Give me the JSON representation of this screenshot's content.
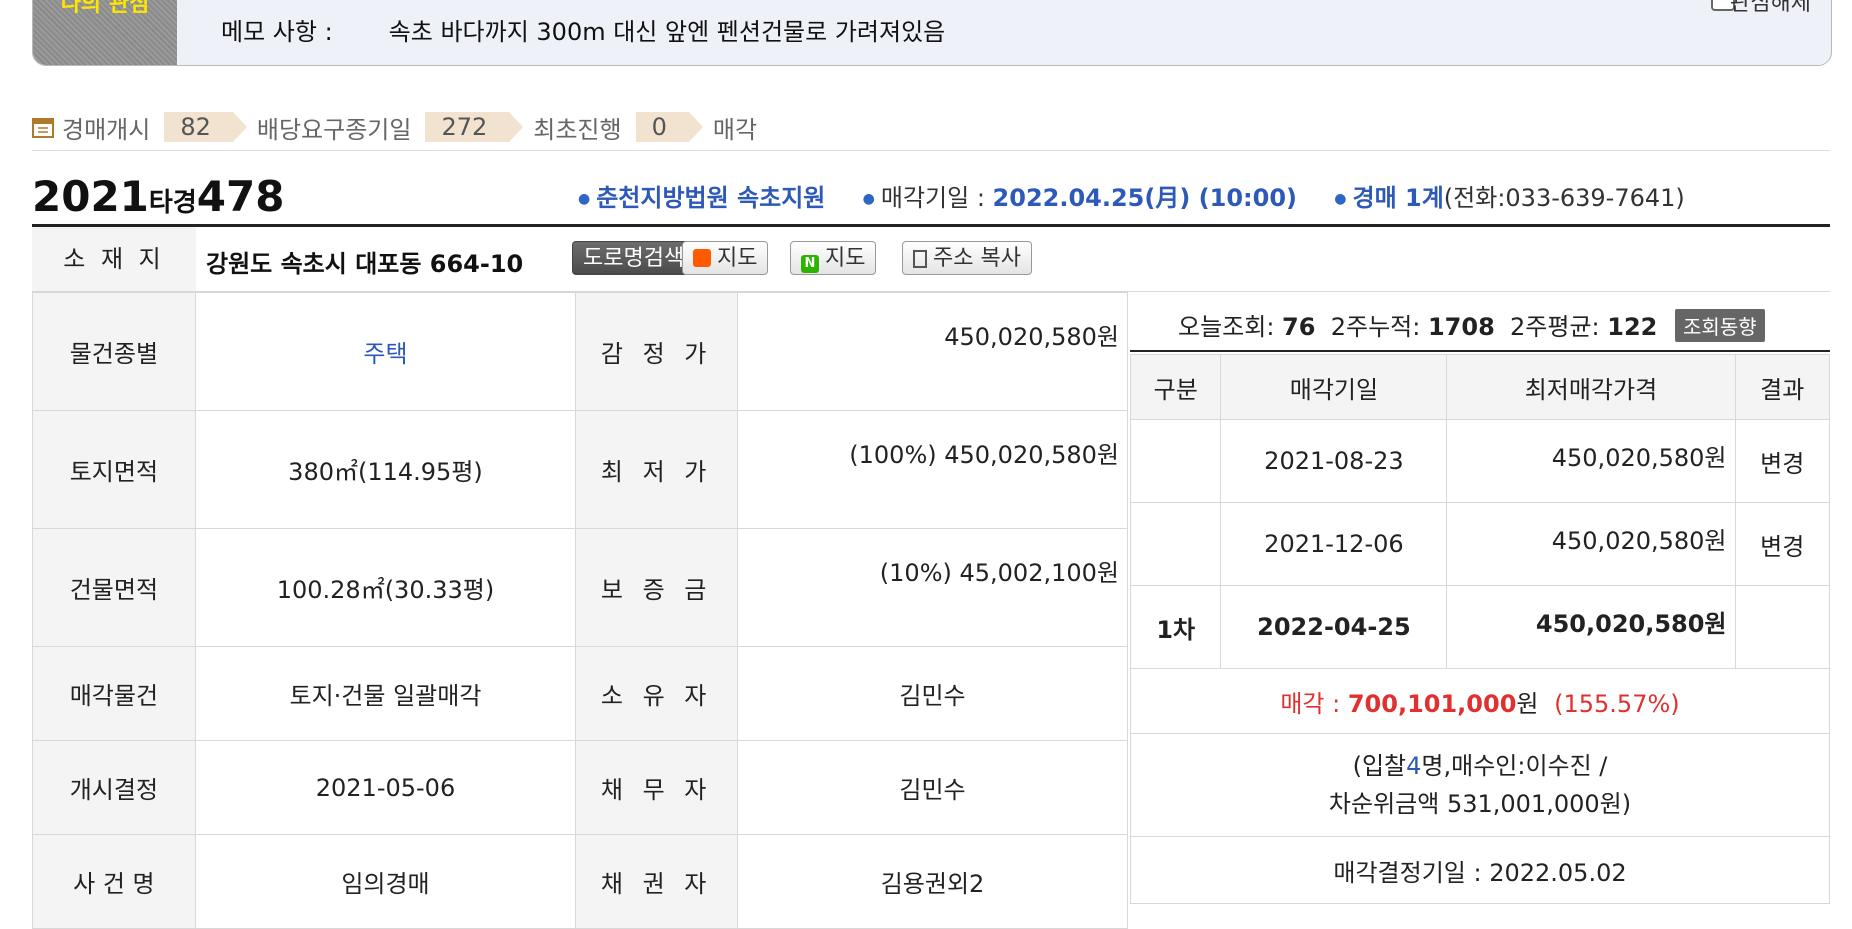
{
  "memo": {
    "tag_label": "나의 관심",
    "label": "메모 사항 :",
    "text": "속초 바다까지 300m 대신 앞엔 펜션건물로 가려져있음",
    "checkbox_label": "관심해제"
  },
  "progress": {
    "steps": [
      {
        "label": "경매개시",
        "count": "82"
      },
      {
        "label": "배당요구종기일",
        "count": "272"
      },
      {
        "label": "최초진행",
        "count": "0"
      },
      {
        "label": "매각",
        "count": ""
      }
    ]
  },
  "case": {
    "year": "2021",
    "type": "타경",
    "number": "478",
    "court": "춘천지방법원 속초지원",
    "sale_date_label": "매각기일 : ",
    "sale_date": "2022.04.25(月) (10:00)",
    "dept": "경매 1계",
    "phone": "(전화:033-639-7641)"
  },
  "address": {
    "label": "소 재 지",
    "value": "강원도 속초시 대포동 664-10",
    "buttons": {
      "road": "도로명검색",
      "daum_map": "지도",
      "naver_map": "지도",
      "copy": "주소 복사"
    }
  },
  "info": [
    {
      "l1": "물건종별",
      "v1": "주택",
      "l2": "감 정 가",
      "v2": "450,020,580원"
    },
    {
      "l1": "토지면적",
      "v1": "380㎡(114.95평)",
      "l2": "최 저 가",
      "v2": "(100%) 450,020,580원"
    },
    {
      "l1": "건물면적",
      "v1": "100.28㎡(30.33평)",
      "l2": "보 증 금",
      "v2": "(10%) 45,002,100원"
    },
    {
      "l1": "매각물건",
      "v1": "토지·건물 일괄매각",
      "l2": "소 유 자",
      "v2": "김민수"
    },
    {
      "l1": "개시결정",
      "v1": "2021-05-06",
      "l2": "채 무 자",
      "v2": "김민수"
    },
    {
      "l1": "사 건 명",
      "v1": "임의경매",
      "l2": "채 권 자",
      "v2": "김용권외2"
    }
  ],
  "views": {
    "today_label": "오늘조회:",
    "today": "76",
    "two_week_label": "2주누적:",
    "two_week": "1708",
    "avg_label": "2주평균:",
    "avg": "122",
    "trend_button": "조회동향"
  },
  "schedule": {
    "headers": [
      "구분",
      "매각기일",
      "최저매각가격",
      "결과"
    ],
    "rows": [
      {
        "round": "",
        "date": "2021-08-23",
        "price": "450,020,580원",
        "result": "변경"
      },
      {
        "round": "",
        "date": "2021-12-06",
        "price": "450,020,580원",
        "result": "변경"
      },
      {
        "round": "1차",
        "date": "2022-04-25",
        "price": "450,020,580원",
        "result": ""
      }
    ],
    "sold_label": "매각 : ",
    "sold_amount": "700,101,000",
    "sold_unit": "원",
    "sold_ratio": "(155.57%)",
    "bid_prefix": "(입찰",
    "bid_count": "4",
    "bid_suffix": "명,매수인:이수진 /",
    "second_bid": "차순위금액 531,001,000원)",
    "decision": "매각결정기일 : 2022.05.02"
  }
}
